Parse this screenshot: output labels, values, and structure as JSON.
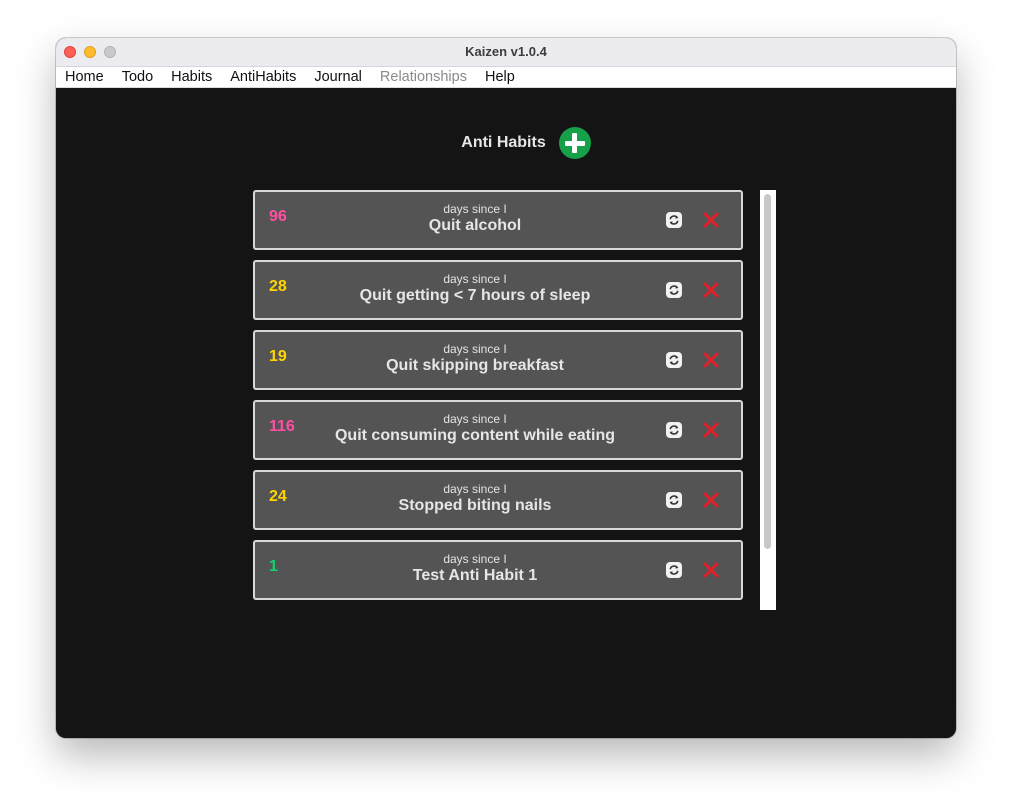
{
  "window": {
    "title": "Kaizen v1.0.4"
  },
  "menu": [
    {
      "label": "Home",
      "enabled": true
    },
    {
      "label": "Todo",
      "enabled": true
    },
    {
      "label": "Habits",
      "enabled": true
    },
    {
      "label": "AntiHabits",
      "enabled": true
    },
    {
      "label": "Journal",
      "enabled": true
    },
    {
      "label": "Relationships",
      "enabled": false
    },
    {
      "label": "Help",
      "enabled": true
    }
  ],
  "page": {
    "heading": "Anti Habits",
    "add_icon": "plus-circle-icon"
  },
  "anti_habits": [
    {
      "days": "96",
      "caption": "days since I",
      "name": "Quit alcohol",
      "days_color": "#ff4fa3"
    },
    {
      "days": "28",
      "caption": "days since I",
      "name": "Quit getting < 7 hours of sleep",
      "days_color": "#ffd500"
    },
    {
      "days": "19",
      "caption": "days since I",
      "name": "Quit skipping breakfast",
      "days_color": "#ffd500"
    },
    {
      "days": "116",
      "caption": "days since I",
      "name": "Quit consuming content while eating",
      "days_color": "#ff4fa3"
    },
    {
      "days": "24",
      "caption": "days since I",
      "name": "Stopped biting nails",
      "days_color": "#ffd500"
    },
    {
      "days": "1",
      "caption": "days since I",
      "name": "Test Anti Habit 1",
      "days_color": "#12d36b"
    }
  ],
  "icons": {
    "reset": "reset-icon",
    "delete": "delete-x-icon"
  },
  "colors": {
    "add_button": "#17a04a",
    "delete": "#e0202b",
    "card_bg": "#545454",
    "window_bg": "#141414"
  }
}
